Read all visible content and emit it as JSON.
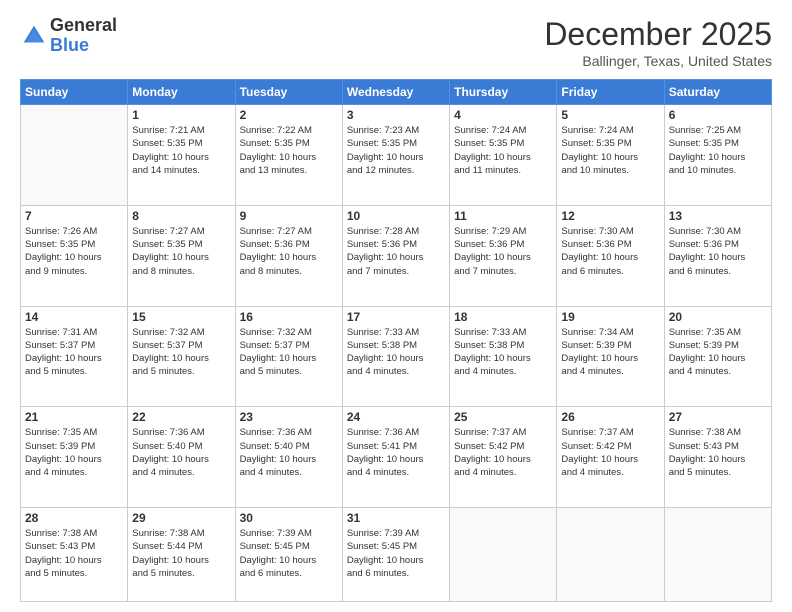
{
  "logo": {
    "general": "General",
    "blue": "Blue"
  },
  "header": {
    "month": "December 2025",
    "location": "Ballinger, Texas, United States"
  },
  "days_of_week": [
    "Sunday",
    "Monday",
    "Tuesday",
    "Wednesday",
    "Thursday",
    "Friday",
    "Saturday"
  ],
  "weeks": [
    [
      {
        "day": "",
        "info": ""
      },
      {
        "day": "1",
        "info": "Sunrise: 7:21 AM\nSunset: 5:35 PM\nDaylight: 10 hours\nand 14 minutes."
      },
      {
        "day": "2",
        "info": "Sunrise: 7:22 AM\nSunset: 5:35 PM\nDaylight: 10 hours\nand 13 minutes."
      },
      {
        "day": "3",
        "info": "Sunrise: 7:23 AM\nSunset: 5:35 PM\nDaylight: 10 hours\nand 12 minutes."
      },
      {
        "day": "4",
        "info": "Sunrise: 7:24 AM\nSunset: 5:35 PM\nDaylight: 10 hours\nand 11 minutes."
      },
      {
        "day": "5",
        "info": "Sunrise: 7:24 AM\nSunset: 5:35 PM\nDaylight: 10 hours\nand 10 minutes."
      },
      {
        "day": "6",
        "info": "Sunrise: 7:25 AM\nSunset: 5:35 PM\nDaylight: 10 hours\nand 10 minutes."
      }
    ],
    [
      {
        "day": "7",
        "info": "Sunrise: 7:26 AM\nSunset: 5:35 PM\nDaylight: 10 hours\nand 9 minutes."
      },
      {
        "day": "8",
        "info": "Sunrise: 7:27 AM\nSunset: 5:35 PM\nDaylight: 10 hours\nand 8 minutes."
      },
      {
        "day": "9",
        "info": "Sunrise: 7:27 AM\nSunset: 5:36 PM\nDaylight: 10 hours\nand 8 minutes."
      },
      {
        "day": "10",
        "info": "Sunrise: 7:28 AM\nSunset: 5:36 PM\nDaylight: 10 hours\nand 7 minutes."
      },
      {
        "day": "11",
        "info": "Sunrise: 7:29 AM\nSunset: 5:36 PM\nDaylight: 10 hours\nand 7 minutes."
      },
      {
        "day": "12",
        "info": "Sunrise: 7:30 AM\nSunset: 5:36 PM\nDaylight: 10 hours\nand 6 minutes."
      },
      {
        "day": "13",
        "info": "Sunrise: 7:30 AM\nSunset: 5:36 PM\nDaylight: 10 hours\nand 6 minutes."
      }
    ],
    [
      {
        "day": "14",
        "info": "Sunrise: 7:31 AM\nSunset: 5:37 PM\nDaylight: 10 hours\nand 5 minutes."
      },
      {
        "day": "15",
        "info": "Sunrise: 7:32 AM\nSunset: 5:37 PM\nDaylight: 10 hours\nand 5 minutes."
      },
      {
        "day": "16",
        "info": "Sunrise: 7:32 AM\nSunset: 5:37 PM\nDaylight: 10 hours\nand 5 minutes."
      },
      {
        "day": "17",
        "info": "Sunrise: 7:33 AM\nSunset: 5:38 PM\nDaylight: 10 hours\nand 4 minutes."
      },
      {
        "day": "18",
        "info": "Sunrise: 7:33 AM\nSunset: 5:38 PM\nDaylight: 10 hours\nand 4 minutes."
      },
      {
        "day": "19",
        "info": "Sunrise: 7:34 AM\nSunset: 5:39 PM\nDaylight: 10 hours\nand 4 minutes."
      },
      {
        "day": "20",
        "info": "Sunrise: 7:35 AM\nSunset: 5:39 PM\nDaylight: 10 hours\nand 4 minutes."
      }
    ],
    [
      {
        "day": "21",
        "info": "Sunrise: 7:35 AM\nSunset: 5:39 PM\nDaylight: 10 hours\nand 4 minutes."
      },
      {
        "day": "22",
        "info": "Sunrise: 7:36 AM\nSunset: 5:40 PM\nDaylight: 10 hours\nand 4 minutes."
      },
      {
        "day": "23",
        "info": "Sunrise: 7:36 AM\nSunset: 5:40 PM\nDaylight: 10 hours\nand 4 minutes."
      },
      {
        "day": "24",
        "info": "Sunrise: 7:36 AM\nSunset: 5:41 PM\nDaylight: 10 hours\nand 4 minutes."
      },
      {
        "day": "25",
        "info": "Sunrise: 7:37 AM\nSunset: 5:42 PM\nDaylight: 10 hours\nand 4 minutes."
      },
      {
        "day": "26",
        "info": "Sunrise: 7:37 AM\nSunset: 5:42 PM\nDaylight: 10 hours\nand 4 minutes."
      },
      {
        "day": "27",
        "info": "Sunrise: 7:38 AM\nSunset: 5:43 PM\nDaylight: 10 hours\nand 5 minutes."
      }
    ],
    [
      {
        "day": "28",
        "info": "Sunrise: 7:38 AM\nSunset: 5:43 PM\nDaylight: 10 hours\nand 5 minutes."
      },
      {
        "day": "29",
        "info": "Sunrise: 7:38 AM\nSunset: 5:44 PM\nDaylight: 10 hours\nand 5 minutes."
      },
      {
        "day": "30",
        "info": "Sunrise: 7:39 AM\nSunset: 5:45 PM\nDaylight: 10 hours\nand 6 minutes."
      },
      {
        "day": "31",
        "info": "Sunrise: 7:39 AM\nSunset: 5:45 PM\nDaylight: 10 hours\nand 6 minutes."
      },
      {
        "day": "",
        "info": ""
      },
      {
        "day": "",
        "info": ""
      },
      {
        "day": "",
        "info": ""
      }
    ]
  ]
}
